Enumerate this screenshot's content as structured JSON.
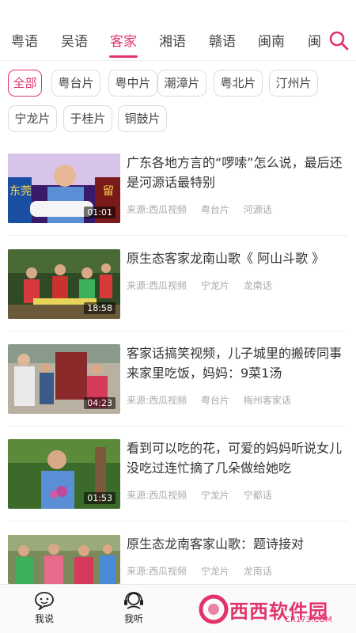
{
  "tabs": [
    {
      "label": "粤语",
      "active": false
    },
    {
      "label": "吴语",
      "active": false
    },
    {
      "label": "客家",
      "active": true
    },
    {
      "label": "湘语",
      "active": false
    },
    {
      "label": "赣语",
      "active": false
    },
    {
      "label": "闽南",
      "active": false
    },
    {
      "label": "闽",
      "active": false
    }
  ],
  "accent_color": "#e2346a",
  "search_icon": "search-icon",
  "chips": [
    {
      "label": "全部",
      "active": true
    },
    {
      "label": "粤台片",
      "active": false
    },
    {
      "label": "粤中片",
      "active": false
    },
    {
      "label": "潮漳片",
      "active": false
    },
    {
      "label": "粤北片",
      "active": false
    },
    {
      "label": "汀州片",
      "active": false
    },
    {
      "label": "宁龙片",
      "active": false
    },
    {
      "label": "于桂片",
      "active": false
    },
    {
      "label": "铜鼓片",
      "active": false
    }
  ],
  "videos": [
    {
      "title": "广东各地方言的“啰嗦”怎么说，最后还是河源话最特别",
      "duration": "01:01",
      "source": "来源:西瓜视频",
      "region": "粤台片",
      "tag": "河源话"
    },
    {
      "title": "原生态客家龙南山歌《 阿山斗歌 》",
      "duration": "18:58",
      "source": "来源:西瓜视频",
      "region": "宁龙片",
      "tag": "龙南话"
    },
    {
      "title": "客家话搞笑视频，儿子城里的搬砖同事来家里吃饭，妈妈：9菜1汤",
      "duration": "04:23",
      "source": "来源:西瓜视频",
      "region": "粤台片",
      "tag": "梅州客家话"
    },
    {
      "title": "看到可以吃的花，可爱的妈妈听说女儿没吃过连忙摘了几朵做给她吃",
      "duration": "01:53",
      "source": "来源:西瓜视频",
      "region": "宁龙片",
      "tag": "宁都话"
    },
    {
      "title": "原生态龙南客家山歌：题诗接对",
      "duration": "",
      "source": "来源:西瓜视频",
      "region": "宁龙片",
      "tag": "龙南话"
    }
  ],
  "bottom_nav": [
    {
      "label": "我说",
      "icon": "speech-bubble-icon"
    },
    {
      "label": "我听",
      "icon": "headphones-icon"
    }
  ],
  "watermark": {
    "text": "西西软件园",
    "domain": "CR173.COM"
  }
}
